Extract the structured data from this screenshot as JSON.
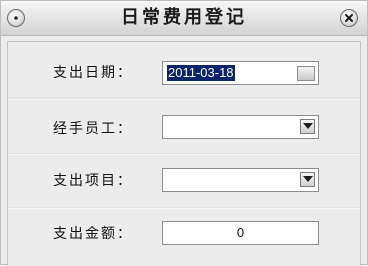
{
  "window": {
    "title": "日常费用登记"
  },
  "form": {
    "date_label": "支出日期：",
    "date_value": "2011-03-18",
    "handler_label": "经手员工：",
    "handler_value": "",
    "item_label": "支出项目：",
    "item_value": "",
    "amount_label": "支出金额：",
    "amount_value": "0"
  },
  "icons": {
    "minimize": "minimize-icon",
    "close": "close-icon",
    "calendar": "calendar-icon",
    "dropdown": "chevron-down-icon"
  },
  "colors": {
    "selection_bg": "#0a246a",
    "window_bg": "#ececec"
  }
}
